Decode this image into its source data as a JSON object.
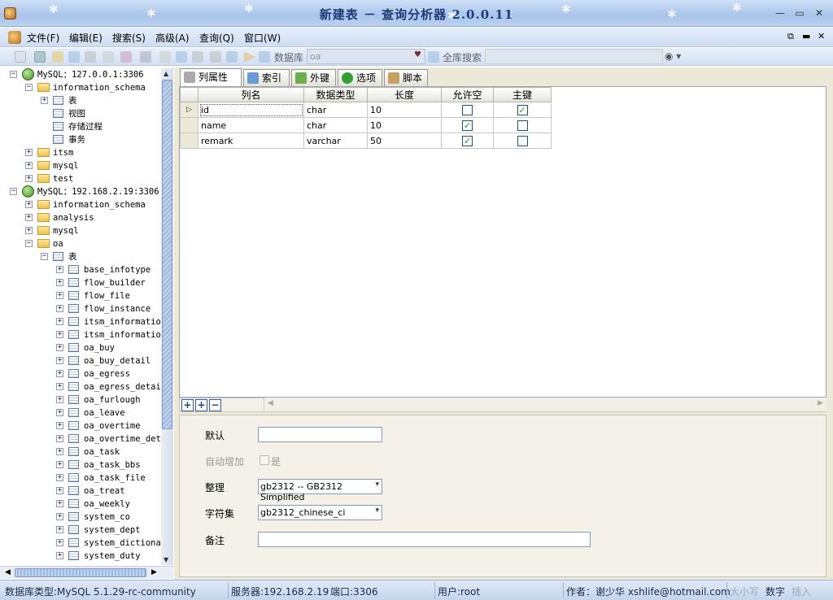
{
  "window": {
    "title": "新建表 － 查询分析器 2.0.0.11"
  },
  "menu": [
    "文件(F)",
    "编辑(E)",
    "搜索(S)",
    "高级(A)",
    "查询(Q)",
    "窗口(W)"
  ],
  "toolbar": {
    "db_label": "数据库",
    "db_value": "oa",
    "search_label": "全库搜索",
    "search_value": ""
  },
  "tree": {
    "server1": "MySQL：127.0.0.1:3306",
    "s1_info": "information_schema",
    "s1_tables": "表",
    "s1_views": "视图",
    "s1_procs": "存储过程",
    "s1_events": "事务",
    "s1_dbs": [
      "itsm",
      "mysql",
      "test"
    ],
    "server2": "MySQL：192.168.2.19:3306",
    "s2_dbs": [
      "information_schema",
      "analysis",
      "mysql",
      "oa"
    ],
    "oa_tables_label": "表",
    "oa_tables": [
      "base_infotype",
      "flow_builder",
      "flow_file",
      "flow_instance",
      "itsm_informatior",
      "itsm_informatior",
      "oa_buy",
      "oa_buy_detail",
      "oa_egress",
      "oa_egress_detail",
      "oa_furlough",
      "oa_leave",
      "oa_overtime",
      "oa_overtime_deta",
      "oa_task",
      "oa_task_bbs",
      "oa_task_file",
      "oa_treat",
      "oa_weekly",
      "system_co",
      "system_dept",
      "system_dictionar",
      "system_duty"
    ]
  },
  "tabs": [
    "列属性",
    "索引",
    "外键",
    "选项",
    "脚本"
  ],
  "grid": {
    "headers": [
      "列名",
      "数据类型",
      "长度",
      "允许空",
      "主键"
    ],
    "rows": [
      {
        "name": "id",
        "type": "char",
        "length": "10",
        "nullable": false,
        "pk": true
      },
      {
        "name": "name",
        "type": "char",
        "length": "10",
        "nullable": true,
        "pk": false
      },
      {
        "name": "remark",
        "type": "varchar",
        "length": "50",
        "nullable": true,
        "pk": false
      }
    ]
  },
  "props": {
    "default_label": "默认",
    "default_value": "",
    "autoinc_label": "自动增加",
    "autoinc_check_label": "是",
    "collation_label": "整理",
    "collation_value": "gb2312 -- GB2312 Simplified",
    "charset_label": "字符集",
    "charset_value": "gb2312_chinese_ci",
    "comment_label": "备注",
    "comment_value": ""
  },
  "status": {
    "dbtype": "数据库类型:MySQL 5.1.29-rc-community",
    "server": "服务器:192.168.2.19",
    "port": "端口:3306",
    "user": "用户:root",
    "author": "作者：谢少华 xshlife@hotmail.com",
    "caps": "大小写",
    "num": "数字",
    "ins": "插入"
  }
}
